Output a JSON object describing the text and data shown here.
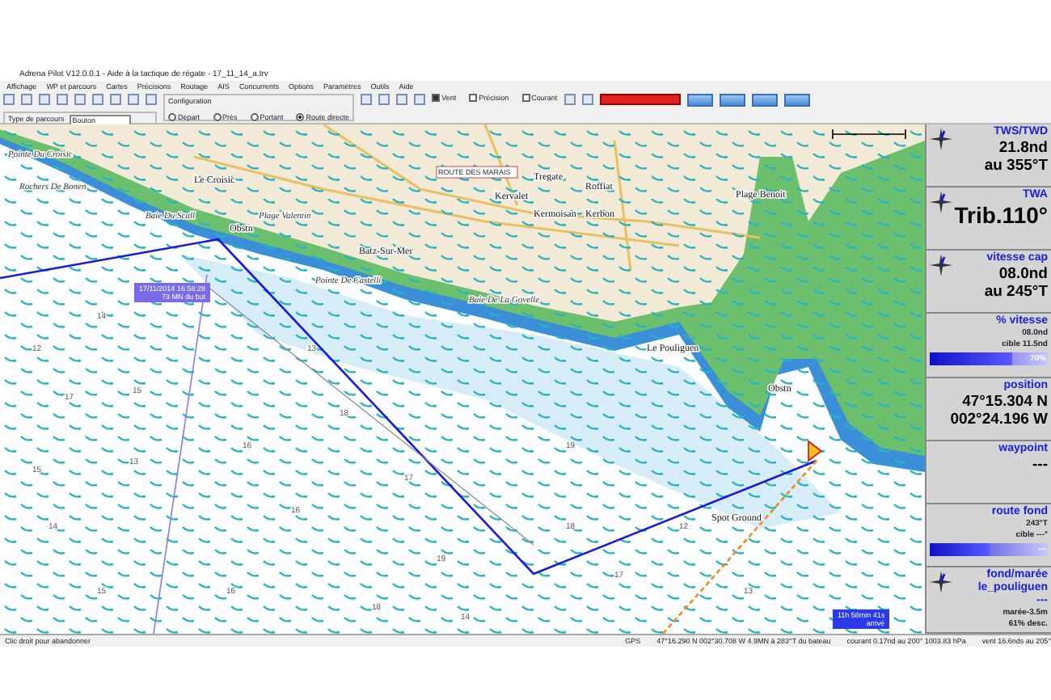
{
  "window": {
    "title": "Adrena Pilot V12.0.0.1 - Aide à la tactique de régate - 17_11_14_a.trv"
  },
  "menu": [
    "Affichage",
    "WP et parcours",
    "Cartes",
    "Précisions",
    "Routage",
    "AIS",
    "Concurrents",
    "Options",
    "Paramètres",
    "Outils",
    "Aide"
  ],
  "toolbar": {
    "course_type": {
      "label": "Type de parcours",
      "value": "Bouton"
    },
    "configuration": {
      "label": "Configuration",
      "options": [
        {
          "label": "Départ",
          "selected": false
        },
        {
          "label": "Près",
          "selected": false
        },
        {
          "label": "Portant",
          "selected": false
        },
        {
          "label": "Route directe",
          "selected": true
        }
      ]
    },
    "layers": [
      {
        "label": "Vent",
        "checked": true
      },
      {
        "label": "Précision",
        "checked": false
      },
      {
        "label": "Courant",
        "checked": false
      }
    ]
  },
  "map": {
    "labels": [
      {
        "text": "Le Croisic",
        "kind": "town"
      },
      {
        "text": "Pointe Du Croisic",
        "kind": "place"
      },
      {
        "text": "Rochers De Bonen",
        "kind": "place"
      },
      {
        "text": "Baie Du Scall",
        "kind": "place"
      },
      {
        "text": "Plage Valentin",
        "kind": "place"
      },
      {
        "text": "Batz-Sur-Mer",
        "kind": "town"
      },
      {
        "text": "Pointe De Castelli",
        "kind": "place"
      },
      {
        "text": "Obstn",
        "kind": "town"
      },
      {
        "text": "Tregate",
        "kind": "town"
      },
      {
        "text": "Kervalet",
        "kind": "town"
      },
      {
        "text": "Roffiat",
        "kind": "town"
      },
      {
        "text": "Kermoisan",
        "kind": "town"
      },
      {
        "text": "Kerbon",
        "kind": "town"
      },
      {
        "text": "ROUTE DES MARAIS",
        "kind": "road"
      },
      {
        "text": "Baie De La Govelle",
        "kind": "place"
      },
      {
        "text": "Le Pouliguen",
        "kind": "town"
      },
      {
        "text": "Plage Benoit",
        "kind": "town"
      },
      {
        "text": "Spot Ground",
        "kind": "town"
      },
      {
        "text": "Obstn",
        "kind": "town"
      }
    ],
    "depths": [
      "14",
      "12",
      "13",
      "15",
      "17",
      "18",
      "16",
      "19",
      "13",
      "15",
      "17",
      "16",
      "14",
      "18",
      "12",
      "19",
      "17",
      "15",
      "16",
      "13",
      "18",
      "14"
    ],
    "tooltips": [
      {
        "kind": "route",
        "lines": [
          "17/11/2014 16:58:28",
          "73 MN du but"
        ]
      },
      {
        "kind": "arrival",
        "lines": [
          "11h 58min 41s",
          "arrivé"
        ]
      }
    ]
  },
  "instruments": [
    {
      "kind": "big",
      "title": "TWS/TWD",
      "values": [
        "21.8nd",
        "au 355°T"
      ]
    },
    {
      "kind": "big",
      "title": "TWA",
      "values": [
        "Trib.110°"
      ]
    },
    {
      "kind": "big",
      "title": "vitesse cap",
      "values": [
        "08.0nd",
        "au 245°T"
      ]
    },
    {
      "kind": "bar",
      "title": "% vitesse",
      "values": [
        "08.0nd",
        "cible 11.5nd"
      ],
      "level": 0.7,
      "reading": "70%"
    },
    {
      "kind": "big",
      "title": "position",
      "values": [
        "47°15.304 N",
        "002°24.196 W"
      ]
    },
    {
      "kind": "big",
      "title": "waypoint",
      "values": [
        "---"
      ]
    },
    {
      "kind": "bar",
      "title": "route fond",
      "values": [
        "243°T",
        "cible ---°"
      ],
      "level": 0.5,
      "reading": "---"
    },
    {
      "kind": "tide",
      "title": "fond/marée",
      "values": [
        "le_pouliguen",
        "---"
      ],
      "small": [
        "marée-3.5m",
        "61% desc."
      ]
    }
  ],
  "status_bar": [
    "Clic droit pour abandonner",
    "GPS",
    "47°16.290 N 002°30.708 W 4.9MN à 283°T du bateau",
    "courant 0.17nd au 200° 1003.83 hPa",
    "vent 16.6nds au 205°"
  ]
}
